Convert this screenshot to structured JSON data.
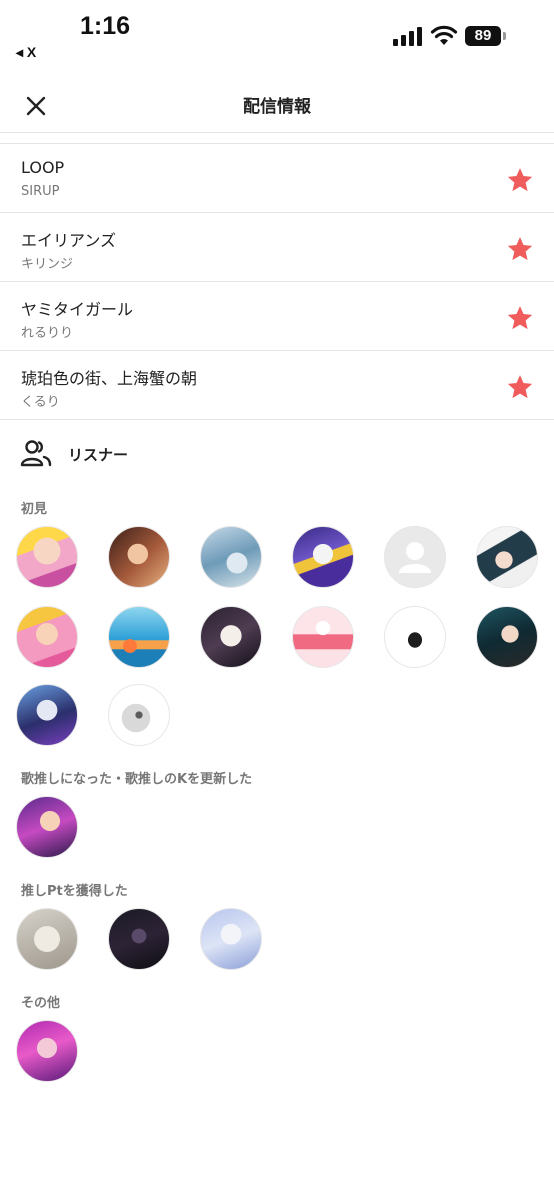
{
  "status_bar": {
    "time": "1:16",
    "back_app": "◂ X",
    "battery": "89"
  },
  "header": {
    "title": "配信情報"
  },
  "songs": [
    {
      "title": "LOOP",
      "artist": "SIRUP"
    },
    {
      "title": "エイリアンズ",
      "artist": "キリンジ"
    },
    {
      "title": "ヤミタイガール",
      "artist": "れるりり"
    },
    {
      "title": "琥珀色の街、上海蟹の朝",
      "artist": "くるり"
    }
  ],
  "listeners": {
    "label": "リスナー",
    "sections": [
      {
        "label": "初見",
        "count": 14
      },
      {
        "label": "歌推しになった・歌推しのKを更新した",
        "count": 1
      },
      {
        "label": "推しPtを獲得した",
        "count": 3
      },
      {
        "label": "その他",
        "count": 1
      }
    ]
  },
  "colors": {
    "star": "#f05b5b",
    "divider": "#e4e4e4",
    "muted_text": "#777777"
  },
  "icons": {
    "close": "close-icon",
    "star": "star-icon",
    "listener": "people-icon",
    "default_avatar": "person-placeholder-icon"
  }
}
